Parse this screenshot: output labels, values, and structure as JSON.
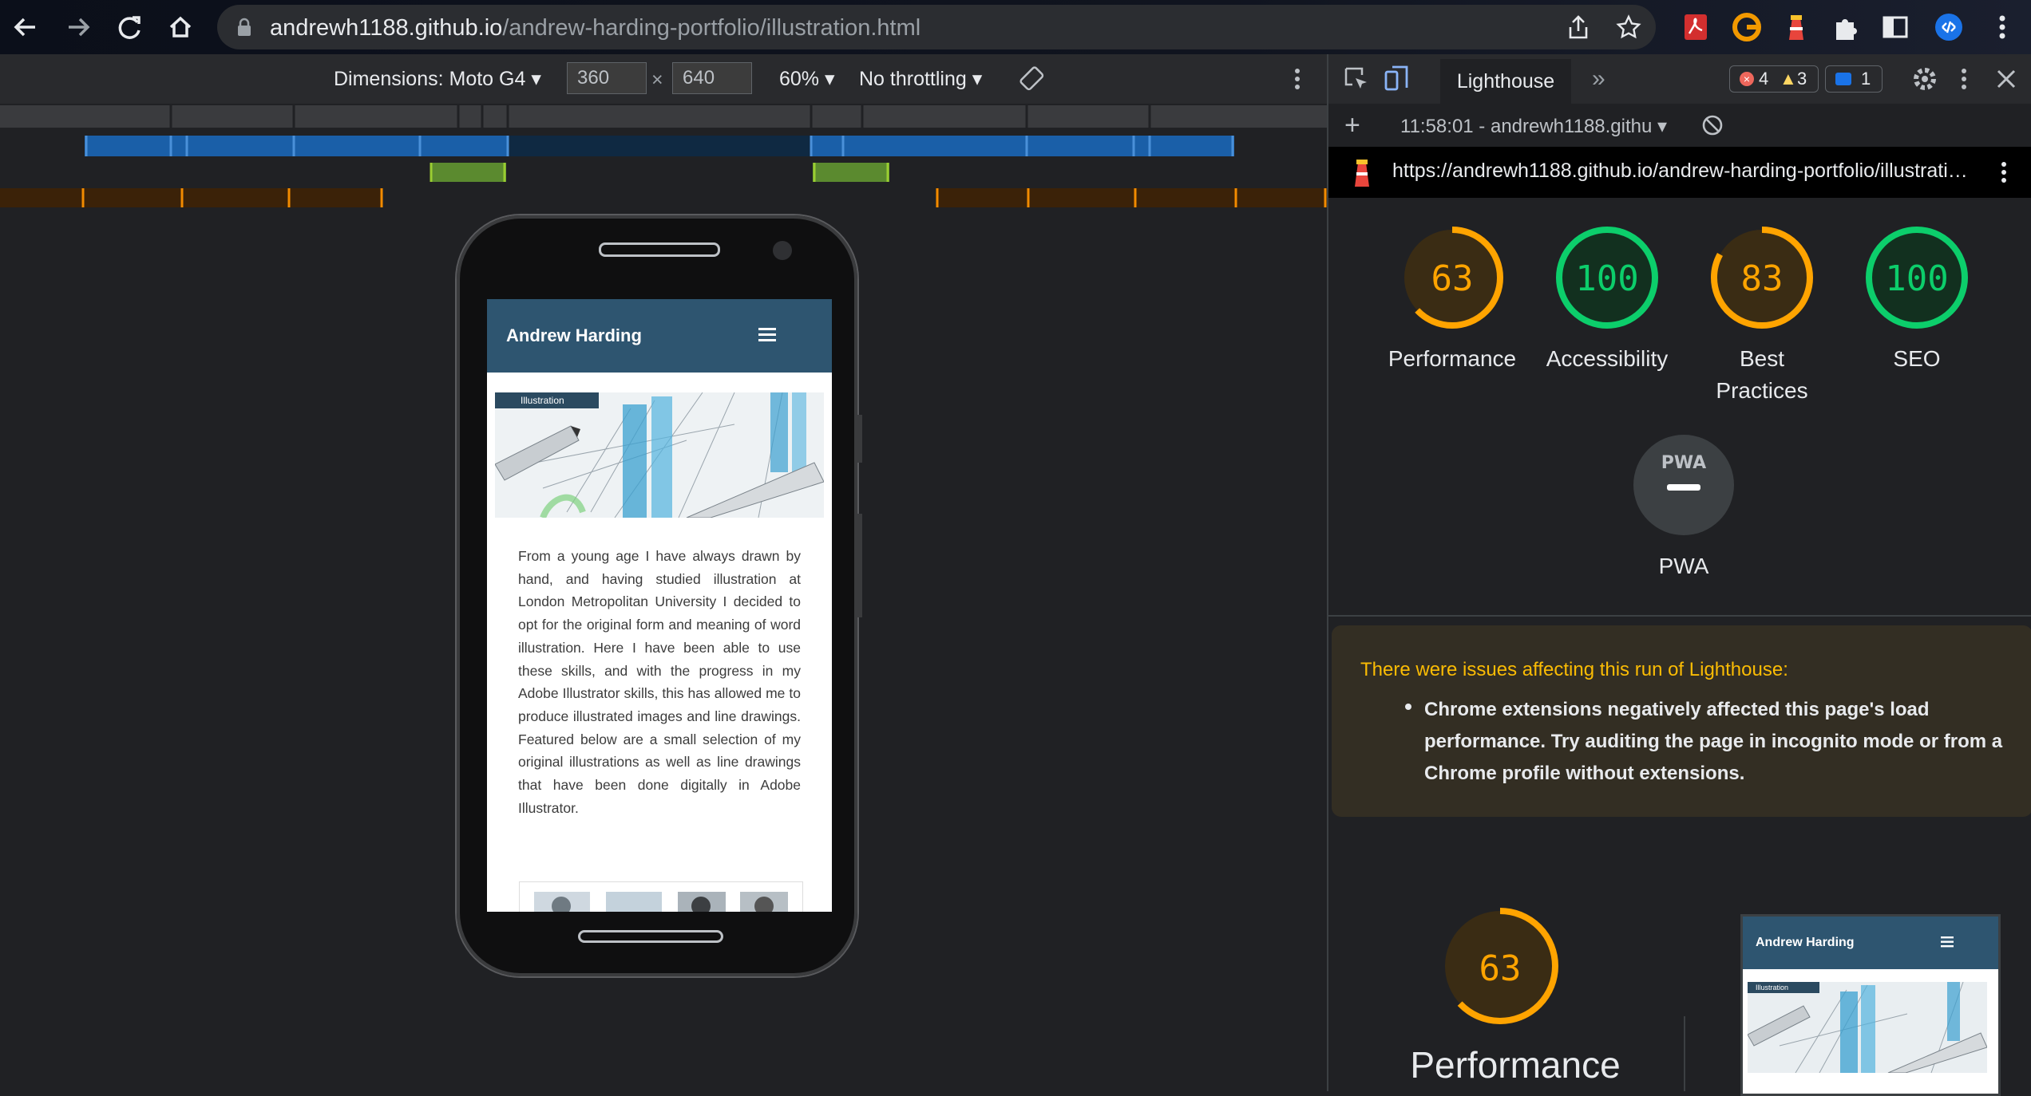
{
  "browser": {
    "url_host": "andrewh1188.github.io",
    "url_path": "/andrew-harding-portfolio/illustration.html"
  },
  "device_toolbar": {
    "dimensions_label": "Dimensions: Moto G4",
    "width_value": "360",
    "times": "×",
    "height_value": "640",
    "zoom": "60%",
    "throttling": "No throttling"
  },
  "site": {
    "title": "Andrew Harding",
    "hero_tag": "Illustration",
    "bio": "From a young age I have always drawn by hand, and having studied illustration at London Metropolitan University I decided to opt for the original form and meaning of word illustration. Here I have been able to use these skills, and with the progress in my Adobe Illustrator skills, this has allowed me to produce illustrated images and line drawings. Featured below are a small selection of my original illustrations as well as line drawings that have been done digitally in Adobe Illustrator."
  },
  "devtools": {
    "tab": "Lighthouse",
    "errors": "4",
    "warnings": "3",
    "messages": "1",
    "report_time": "11:58:01 - andrewh1188.githu",
    "report_url": "https://andrewh1188.github.io/andrew-harding-portfolio/illustrati…",
    "scores": [
      {
        "label": "Performance",
        "value": 63,
        "color": "#ffa400"
      },
      {
        "label": "Accessibility",
        "value": 100,
        "color": "#0cce6b"
      },
      {
        "label": "Best Practices",
        "value": 83,
        "color": "#ffa400"
      },
      {
        "label": "SEO",
        "value": 100,
        "color": "#0cce6b"
      }
    ],
    "pwa_label": "PWA",
    "pwa_badge": "PWA",
    "warning_title": "There were issues affecting this run of Lighthouse:",
    "warning_item": "Chrome extensions negatively affected this page's load performance. Try auditing the page in incognito mode or from a Chrome profile without extensions.",
    "perf_score": 63,
    "perf_label": "Performance",
    "thumb_title": "Andrew Harding",
    "thumb_tag": "Illustration"
  }
}
